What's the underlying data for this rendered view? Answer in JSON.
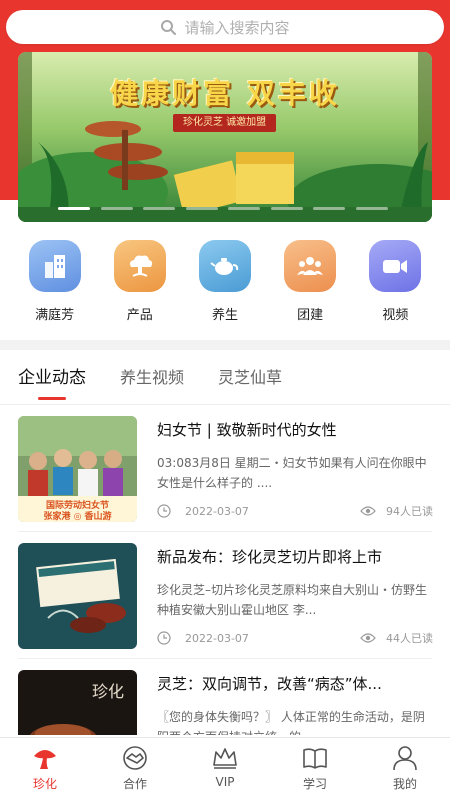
{
  "search": {
    "placeholder": "请输入搜索内容"
  },
  "banner": {
    "title": "健康财富  双丰收",
    "subtitle": "珍化灵芝  诚邀加盟",
    "slide_count": 8,
    "active_slide": 1
  },
  "categories": [
    {
      "label": "满庭芳",
      "icon": "building-icon",
      "color": "#6fa0e8"
    },
    {
      "label": "产品",
      "icon": "cloud-icon",
      "color": "#f0a450"
    },
    {
      "label": "养生",
      "icon": "teapot-icon",
      "color": "#5aa7d8"
    },
    {
      "label": "团建",
      "icon": "team-icon",
      "color": "#f09a5a"
    },
    {
      "label": "视频",
      "icon": "video-camera-icon",
      "color": "#7d82ee"
    }
  ],
  "tabs": [
    {
      "label": "企业动态",
      "active": true
    },
    {
      "label": "养生视频",
      "active": false
    },
    {
      "label": "灵芝仙草",
      "active": false
    }
  ],
  "news": [
    {
      "title": "妇女节 | 致敬新时代的女性",
      "summary": "03:083月8日 星期二・妇女节如果有人问在你眼中 女性是什么样子的 ....",
      "date": "2022-03-07",
      "views": "94人已读",
      "thumb_caption_1": "国际劳动妇女节",
      "thumb_caption_2": "张家港 ◎ 香山游"
    },
    {
      "title": "新品发布：珍化灵芝切片即将上市",
      "summary": "珍化灵芝–切片珍化灵芝原料均来自大别山・仿野生种植安徽大别山霍山地区 李...",
      "date": "2022-03-07",
      "views": "44人已读"
    },
    {
      "title": "灵芝：双向调节，改善“病态”体...",
      "summary": "〖您的身体失衡吗？〗 人体正常的生命活动，是阴阳两个方面保持对立统一的...",
      "thumb_caption_1": "珍化"
    }
  ],
  "tabbar": [
    {
      "label": "珍化",
      "icon": "mushroom-icon",
      "active": true
    },
    {
      "label": "合作",
      "icon": "handshake-icon",
      "active": false
    },
    {
      "label": "VIP",
      "icon": "crown-icon",
      "active": false
    },
    {
      "label": "学习",
      "icon": "book-icon",
      "active": false
    },
    {
      "label": "我的",
      "icon": "user-icon",
      "active": false
    }
  ],
  "colors": {
    "brand": "#e8362f",
    "text": "#222222",
    "muted": "#999999"
  }
}
